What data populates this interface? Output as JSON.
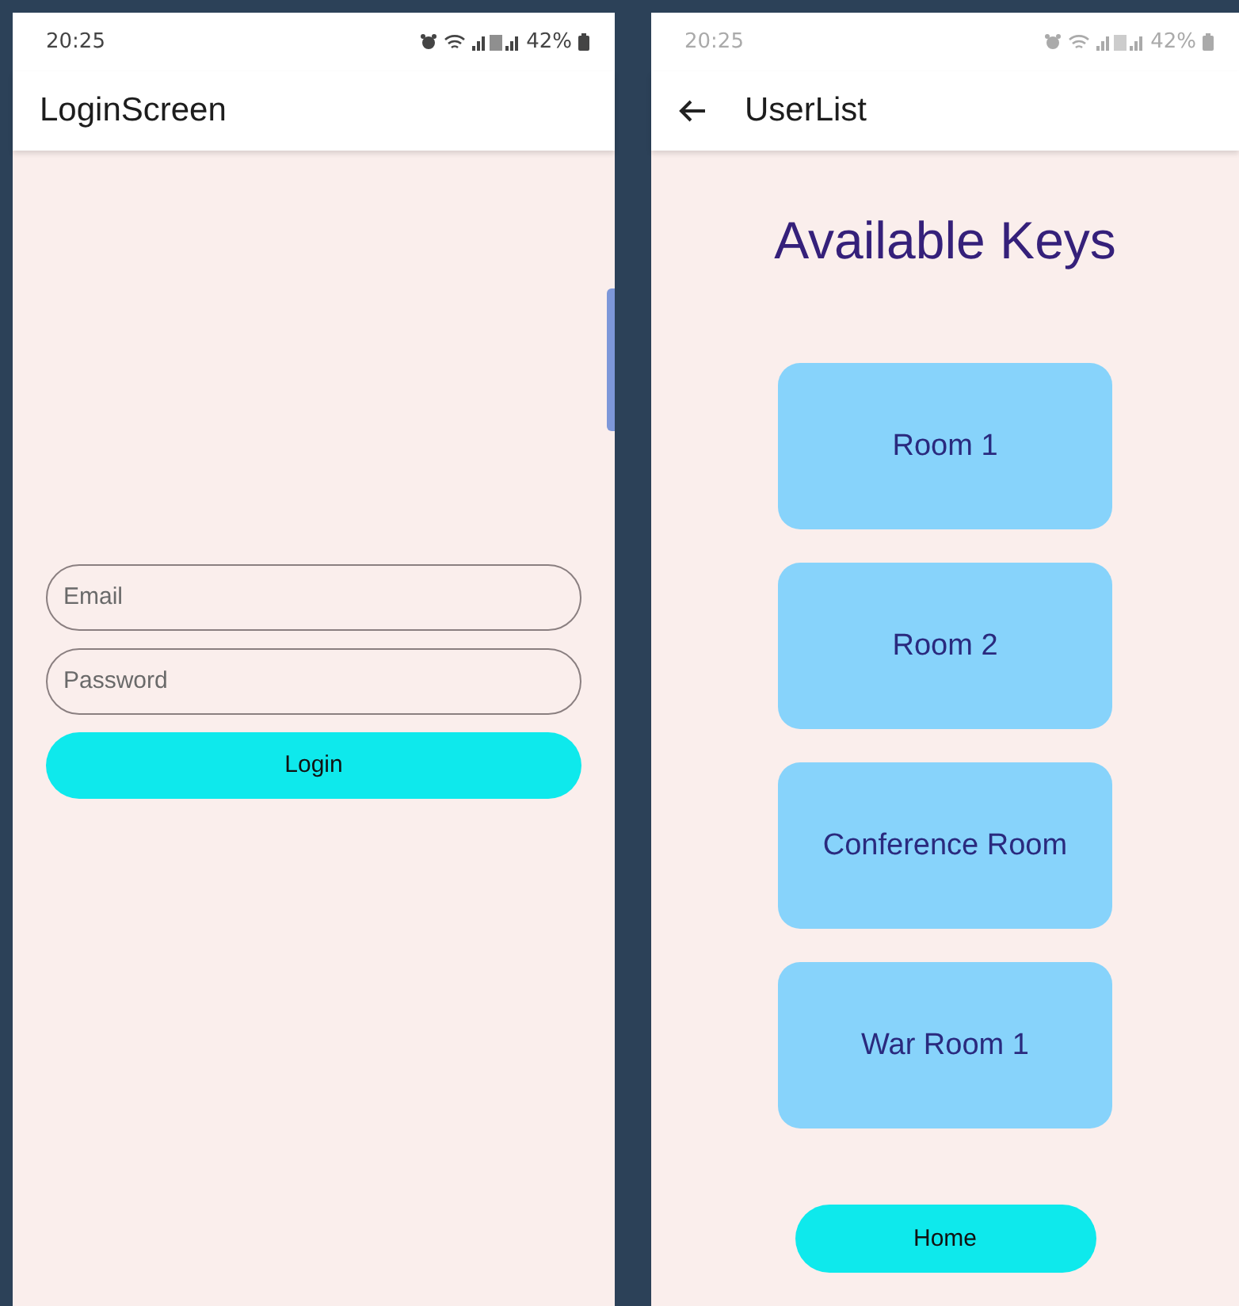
{
  "screens": [
    {
      "kind": "login",
      "status_bar": {
        "time": "20:25",
        "battery": "42%",
        "dimmed": false
      },
      "title": "LoginScreen",
      "back": false,
      "edge_handle": true,
      "fields": [
        {
          "placeholder": "Email"
        },
        {
          "placeholder": "Password"
        }
      ],
      "button": "Login"
    },
    {
      "kind": "list",
      "status_bar": {
        "time": "20:25",
        "battery": "42%",
        "dimmed": true
      },
      "title": "UserList",
      "back": true,
      "edge_handle": false,
      "heading": "Available Keys",
      "keys": [
        "Room 1",
        "Room 2",
        "Conference Room",
        "War Room 1"
      ],
      "button": "Home"
    }
  ]
}
